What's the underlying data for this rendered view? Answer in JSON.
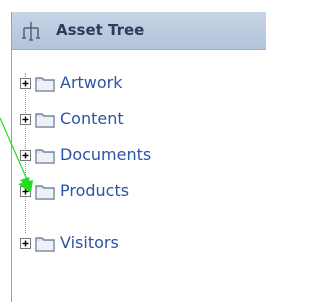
{
  "panel": {
    "title": "Asset Tree",
    "title_icon": "tree-structure-icon"
  },
  "tree": {
    "items": [
      {
        "label": "Artwork",
        "icon": "folder-icon",
        "expander": "plus-expander-icon"
      },
      {
        "label": "Content",
        "icon": "folder-icon",
        "expander": "plus-expander-icon"
      },
      {
        "label": "Documents",
        "icon": "folder-icon",
        "expander": "plus-expander-icon"
      },
      {
        "label": "Products",
        "icon": "folder-icon",
        "expander": "plus-expander-icon"
      },
      {
        "label": "Visitors",
        "icon": "folder-icon",
        "expander": "plus-expander-icon"
      }
    ]
  },
  "colors": {
    "header_bg": "#b8c7dc",
    "label_text": "#2b54a6",
    "pointer_arrow": "#22dd22"
  },
  "annotation": {
    "icon": "green-pointer-arrow-icon"
  }
}
